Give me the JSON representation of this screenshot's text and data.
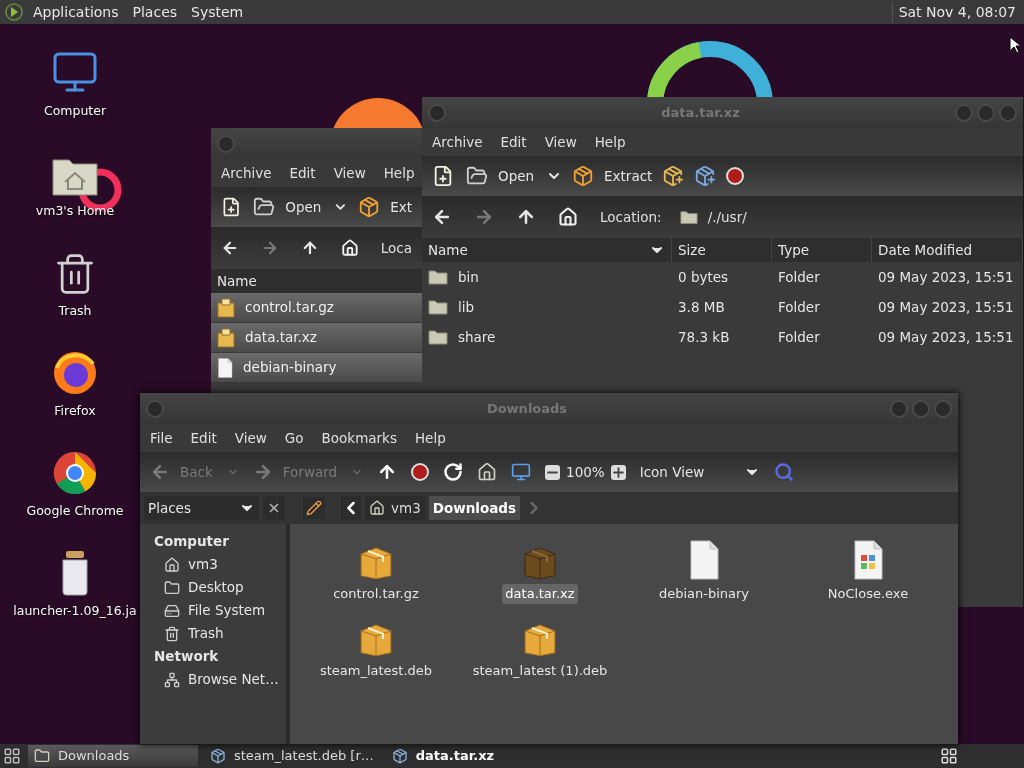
{
  "top_panel": {
    "menus": [
      "Applications",
      "Places",
      "System"
    ],
    "clock": "Sat Nov 4, 08:07"
  },
  "desktop_icons": [
    {
      "label": "Computer",
      "kind": "computer"
    },
    {
      "label": "vm3's Home",
      "kind": "home"
    },
    {
      "label": "Trash",
      "kind": "trash"
    },
    {
      "label": "Firefox",
      "kind": "firefox"
    },
    {
      "label": "Google Chrome",
      "kind": "chrome"
    },
    {
      "label": "launcher-1.09_16.ja",
      "kind": "jar"
    }
  ],
  "back_archive_window": {
    "menus": [
      "Archive",
      "Edit",
      "View",
      "Help"
    ],
    "open_label": "Open",
    "extract_label": "Ext",
    "forward_disabled": true,
    "location_label": "Loca",
    "column": "Name",
    "rows": [
      {
        "name": "control.tar.gz",
        "kind": "archive"
      },
      {
        "name": "data.tar.xz",
        "kind": "archive"
      },
      {
        "name": "debian-binary",
        "kind": "file"
      }
    ]
  },
  "archive_window": {
    "title": "data.tar.xz",
    "menus": [
      "Archive",
      "Edit",
      "View",
      "Help"
    ],
    "open_label": "Open",
    "extract_label": "Extract",
    "forward_disabled": true,
    "location_label": "Location:",
    "path": "/./usr/",
    "columns": [
      "Name",
      "Size",
      "Type",
      "Date Modified"
    ],
    "rows": [
      {
        "name": "bin",
        "size": "0 bytes",
        "type": "Folder",
        "modified": "09 May 2023, 15:51"
      },
      {
        "name": "lib",
        "size": "3.8 MB",
        "type": "Folder",
        "modified": "09 May 2023, 15:51"
      },
      {
        "name": "share",
        "size": "78.3 kB",
        "type": "Folder",
        "modified": "09 May 2023, 15:51"
      }
    ]
  },
  "file_manager": {
    "title": "Downloads",
    "menus": [
      "File",
      "Edit",
      "View",
      "Go",
      "Bookmarks",
      "Help"
    ],
    "back": {
      "label": "Back",
      "disabled": true
    },
    "forward": {
      "label": "Forward",
      "disabled": true
    },
    "zoom": "100%",
    "view_mode": "Icon View",
    "sidebar": {
      "selector": "Places",
      "sections": [
        {
          "heading": "Computer",
          "items": [
            {
              "label": "vm3",
              "kind": "home"
            },
            {
              "label": "Desktop",
              "kind": "desktop"
            },
            {
              "label": "File System",
              "kind": "drive"
            },
            {
              "label": "Trash",
              "kind": "trash"
            }
          ]
        },
        {
          "heading": "Network",
          "items": [
            {
              "label": "Browse Net…",
              "kind": "network"
            }
          ]
        }
      ]
    },
    "breadcrumbs": [
      {
        "label": "vm3",
        "selected": false
      },
      {
        "label": "Downloads",
        "selected": true
      }
    ],
    "files": [
      {
        "name": "control.tar.gz",
        "kind": "package",
        "selected": false
      },
      {
        "name": "data.tar.xz",
        "kind": "package",
        "selected": true
      },
      {
        "name": "debian-binary",
        "kind": "file",
        "selected": false
      },
      {
        "name": "NoClose.exe",
        "kind": "exe",
        "selected": false
      },
      {
        "name": "steam_latest.deb",
        "kind": "package",
        "selected": false
      },
      {
        "name": "steam_latest (1).deb",
        "kind": "package",
        "selected": false
      }
    ]
  },
  "taskbar": {
    "items": [
      {
        "label": "Downloads",
        "kind": "folder",
        "selected": true,
        "highlighted": false
      },
      {
        "label": "steam_latest.deb [r…",
        "kind": "installer",
        "selected": false,
        "highlighted": false
      },
      {
        "label": "data.tar.xz",
        "kind": "installer",
        "selected": false,
        "highlighted": true
      }
    ]
  }
}
